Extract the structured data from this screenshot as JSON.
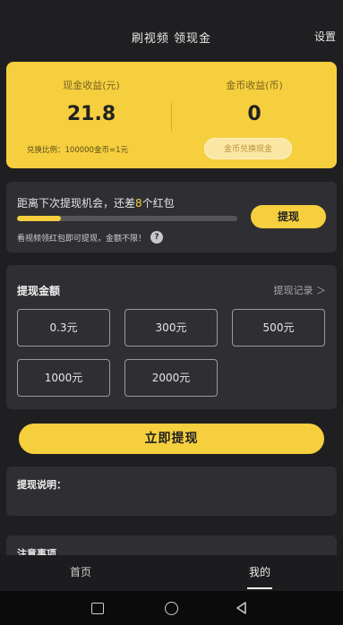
{
  "header": {
    "title": "刷视频 领现金",
    "settings_label": "设置"
  },
  "earnings": {
    "cash_label": "现金收益(元)",
    "cash_value": "21.8",
    "coin_label": "金币收益(币)",
    "coin_value": "0",
    "exchange_rate": "兑换比例：100000金币=1元",
    "exchange_button": "金币兑换现金"
  },
  "progress": {
    "head_prefix": "距离下次提现机会，还差",
    "remaining": "8",
    "head_suffix": "个红包",
    "fill_fraction": 0.2,
    "withdraw_button": "提现",
    "note": "看视频领红包即可提现，金额不限！",
    "help_icon": "?"
  },
  "amount": {
    "title": "提现金额",
    "record_link": "提现记录 ＞",
    "options": [
      "0.3元",
      "300元",
      "500元",
      "1000元",
      "2000元"
    ]
  },
  "main_button": "立即提现",
  "instructions_title": "提现说明：",
  "notice_title": "注意事项",
  "tabs": {
    "home": "首页",
    "mine": "我的"
  },
  "colors": {
    "accent": "#f6cf3f",
    "background": "#1f1f21",
    "card": "#2f2f33"
  }
}
